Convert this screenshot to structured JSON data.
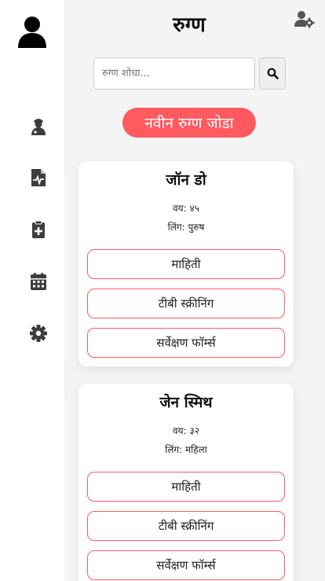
{
  "header": {
    "title": "रुग्ण"
  },
  "search": {
    "placeholder": "रुग्ण शोधा..."
  },
  "add_patient_label": "नवीन रुग्ण जोडा",
  "icons": {
    "avatar": "user-avatar-icon",
    "user_settings": "user-cog-icon",
    "search": "search-icon",
    "nav": [
      "doctor-icon",
      "medical-file-icon",
      "clipboard-plus-icon",
      "calendar-icon",
      "gear-icon"
    ]
  },
  "patients": [
    {
      "name": "जॉन डो",
      "age": "वय: ४५",
      "gender": "लिंग: पुरुष",
      "buttons": [
        "माहिती",
        "टीबी स्क्रीनिंग",
        "सर्वेक्षण फॉर्म्स"
      ]
    },
    {
      "name": "जेन स्मिथ",
      "age": "वय: ३२",
      "gender": "लिंग: महिला",
      "buttons": [
        "माहिती",
        "टीबी स्क्रीनिंग",
        "सर्वेक्षण फॉर्म्स"
      ]
    }
  ],
  "colors": {
    "accent": "#ff5a5f",
    "icon": "#3d3d3d",
    "background": "#f4f4f4"
  }
}
